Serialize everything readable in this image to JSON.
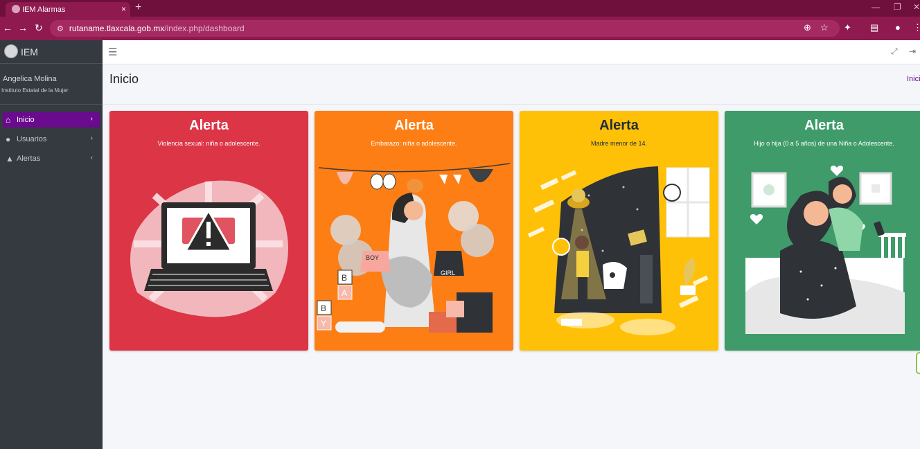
{
  "browser": {
    "tab_title": "IEM Alarmas",
    "tab_close": "×",
    "new_tab": "+",
    "url_host": "rutaname.tlaxcala.gob.mx",
    "url_path": "/index.php/dashboard"
  },
  "sidebar": {
    "brand": "IEM",
    "user_name": "Angelica Molina",
    "user_org": "Instituto Estatal de la Mujer",
    "items": [
      {
        "label": "Inicio",
        "icon": "home-icon",
        "arrow": "›",
        "active": true
      },
      {
        "label": "Usuarios",
        "icon": "user-icon",
        "arrow": "›",
        "active": false
      },
      {
        "label": "Alertas",
        "icon": "warning-icon",
        "arrow": "‹",
        "active": false
      }
    ]
  },
  "header": {
    "title": "Inicio",
    "breadcrumb": "Inicio"
  },
  "cards": [
    {
      "title": "Alerta",
      "subtitle": "Violencia sexual: niña o adolescente.",
      "color": "#dc3545"
    },
    {
      "title": "Alerta",
      "subtitle": "Embarazo: niña o adolescente.",
      "color": "#fd7e14"
    },
    {
      "title": "Alerta",
      "subtitle": "Madre menor de 14.",
      "color": "#ffc107"
    },
    {
      "title": "Alerta",
      "subtitle": "Hijo o hija (0 a 5 años) de una Niña o Adolescente.",
      "color": "#3f9b6a"
    }
  ],
  "illustration_labels": {
    "boy": "BOY",
    "girl": "GIRL",
    "blocks": [
      "B",
      "A",
      "B",
      "Y"
    ]
  },
  "colors": {
    "sidebar_bg": "#343a40",
    "active_item": "#6a0a8e",
    "browser_chrome": "#8e1a50"
  }
}
